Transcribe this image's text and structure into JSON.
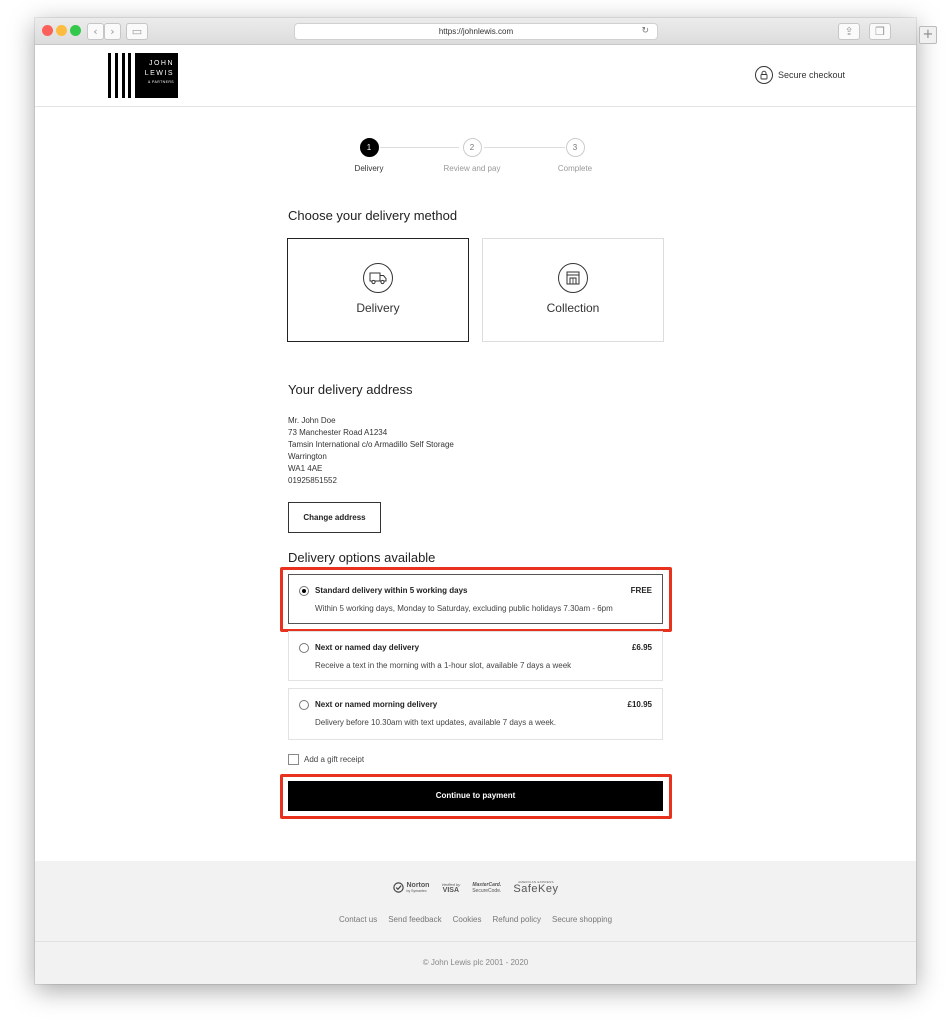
{
  "browser": {
    "url": "https://johnlewis.com",
    "traffic_lights": [
      "#fc605b",
      "#fdbc40",
      "#34c84a"
    ]
  },
  "header": {
    "logo": {
      "line1": "JOHN",
      "line2": "LEWIS",
      "line3": "& PARTNERS"
    },
    "secure_checkout": "Secure checkout",
    "icon": "lock-icon"
  },
  "steps": [
    {
      "number": "1",
      "label": "Delivery",
      "active": true
    },
    {
      "number": "2",
      "label": "Review and pay",
      "active": false
    },
    {
      "number": "3",
      "label": "Complete",
      "active": false
    }
  ],
  "delivery_method": {
    "heading": "Choose your delivery method",
    "options": [
      {
        "label": "Delivery",
        "icon": "van-icon",
        "selected": true
      },
      {
        "label": "Collection",
        "icon": "store-icon",
        "selected": false
      }
    ]
  },
  "address": {
    "heading": "Your delivery address",
    "lines": [
      "Mr. John Doe",
      "73 Manchester Road A1234",
      "Tamsin International c/o Armadillo Self Storage",
      "Warrington",
      "WA1 4AE",
      "01925851552"
    ],
    "change_button": "Change address"
  },
  "delivery_options": {
    "heading": "Delivery options available",
    "options": [
      {
        "title": "Standard delivery within 5 working days",
        "price": "FREE",
        "description": "Within 5 working days, Monday to Saturday, excluding public holidays 7.30am - 6pm",
        "selected": true
      },
      {
        "title": "Next or named day delivery",
        "price": "£6.95",
        "description": "Receive a text in the morning with a 1-hour slot, available 7 days a week",
        "selected": false
      },
      {
        "title": "Next or named morning delivery",
        "price": "£10.95",
        "description": "Delivery before 10.30am with text updates, available 7 days a week.",
        "selected": false
      }
    ]
  },
  "gift_receipt": {
    "label": "Add a gift receipt",
    "checked": false
  },
  "continue_button": "Continue to payment",
  "highlight_color": "#e8321e",
  "footer": {
    "badges": [
      {
        "name": "norton-badge",
        "line1": "Norton",
        "line2": "by Symantec"
      },
      {
        "name": "visa-badge",
        "line1": "Verified by",
        "line2": "VISA"
      },
      {
        "name": "mastercard-badge",
        "line1": "MasterCard.",
        "line2": "SecureCode."
      },
      {
        "name": "safekey-badge",
        "line1": "AMERICAN EXPRESS",
        "line2": "SafeKey"
      }
    ],
    "links": [
      "Contact us",
      "Send feedback",
      "Cookies",
      "Refund policy",
      "Secure shopping"
    ],
    "copyright": "© John Lewis plc 2001 - 2020"
  }
}
